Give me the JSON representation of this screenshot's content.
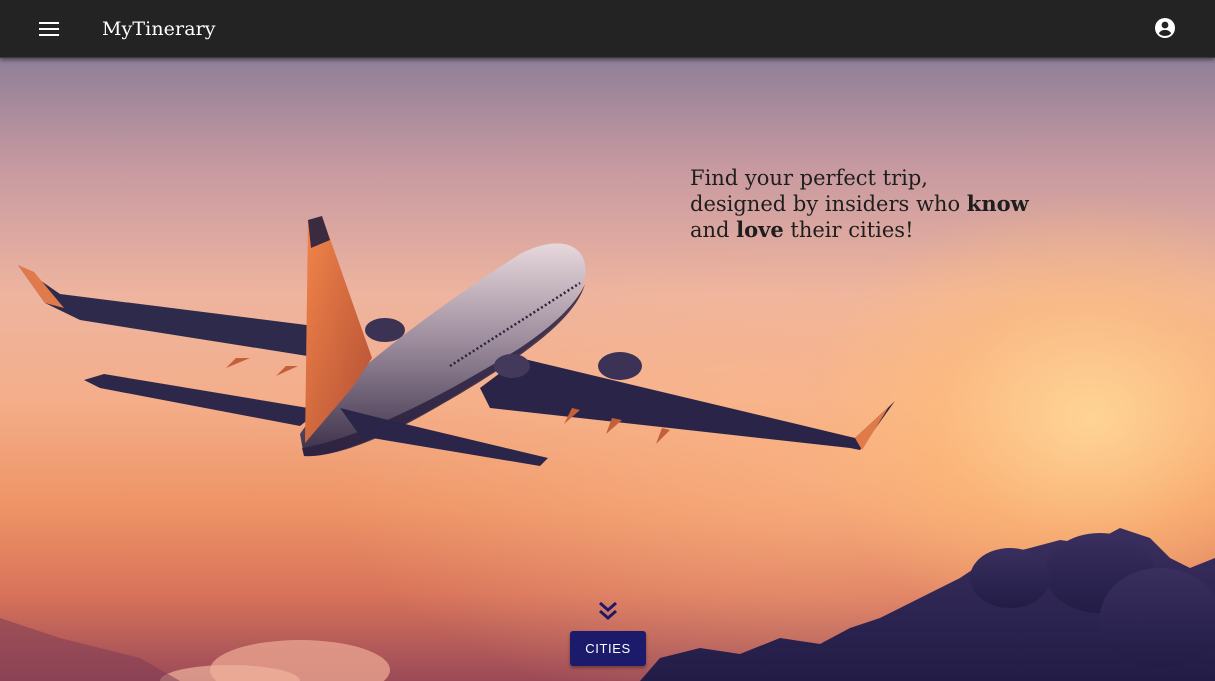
{
  "app": {
    "title": "MyTinerary"
  },
  "header": {
    "menu_icon": "hamburger-menu-icon",
    "account_icon": "account-circle-icon"
  },
  "hero": {
    "tagline_line1": "Find your perfect trip,",
    "tagline_line2_pre": "designed by insiders who ",
    "tagline_line2_bold": "know",
    "tagline_line3_pre": "and ",
    "tagline_line3_bold": "love",
    "tagline_line3_post": " their cities!",
    "scroll_icon": "double-chevron-down-icon",
    "cities_button_label": "CITIES"
  },
  "colors": {
    "appbar_bg": "#232323",
    "button_bg": "#1c1b6b",
    "button_text": "#ffffff"
  }
}
